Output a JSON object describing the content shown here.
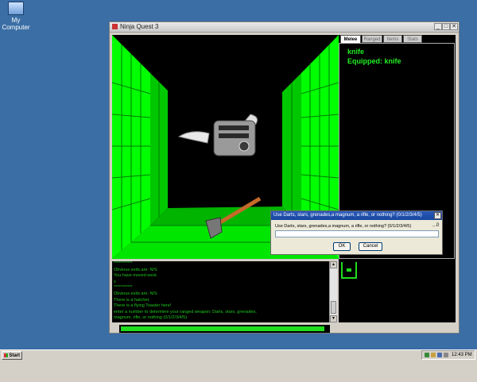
{
  "desktop": {
    "icon_label": "My Computer",
    "icon": "my-computer-icon"
  },
  "window": {
    "title": "Ninja Quest 3",
    "icons": {
      "min": "minimize-icon",
      "max": "maximize-icon",
      "close": "close-icon"
    }
  },
  "tabs": [
    "Melee",
    "Ranged",
    "Items",
    "Stats"
  ],
  "active_tab": "Melee",
  "weapon_panel": {
    "line1": "knife",
    "line2": "Equipped: knife"
  },
  "messages": [
    "***********",
    "Obvious exits are: N/S",
    "You have moved west.",
    "s",
    "***********",
    "Obvious exits are: N/S",
    "There is a hatchet.",
    "There is a flying Toaster here!",
    "enter a number to determine your ranged weapon: Darts, stars, grenades,",
    "magnum, rifle, or nothing (0/1/2/3/4/5)"
  ],
  "health": {
    "fraction": 0.98,
    "color": "#1fdc1f"
  },
  "dialog": {
    "title": "Use Darts, stars, grenades,a magnum, a rifle, or nothing? (0/1/2/3/4/5)",
    "prompt": "Use Darts, stars, grenades,a magnum, a rifle, or nothing? (0/1/2/3/4/5)",
    "caret": "...0",
    "input_value": "",
    "ok_label": "OK",
    "cancel_label": "Cancel",
    "close_icon": "close-icon"
  },
  "taskbar": {
    "start_label": "Start",
    "clock": "12:43 PM"
  },
  "colors": {
    "wall": "#00ff00",
    "wall_dark": "#00a000",
    "text_green": "#22ee22",
    "desktop": "#3a6ea5"
  }
}
